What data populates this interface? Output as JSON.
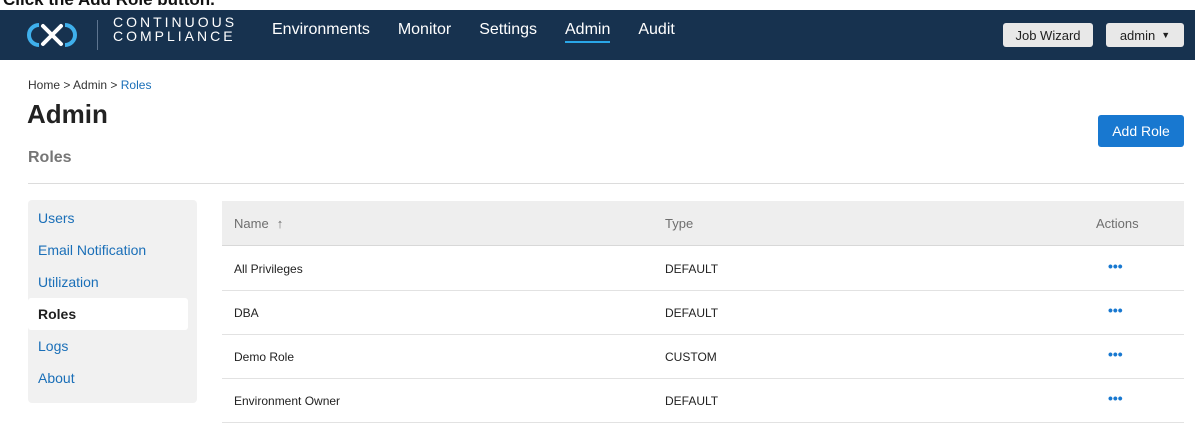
{
  "instruction": "Click the Add Role button.",
  "header": {
    "logo_line1": "CONTINUOUS",
    "logo_line2": "COMPLIANCE",
    "nav": [
      {
        "label": "Environments"
      },
      {
        "label": "Monitor"
      },
      {
        "label": "Settings"
      },
      {
        "label": "Admin",
        "active": true
      },
      {
        "label": "Audit"
      }
    ],
    "job_wizard_label": "Job Wizard",
    "user_label": "admin",
    "brand_color": "#17324f",
    "active_underline_color": "#2aa7e8"
  },
  "breadcrumb": {
    "home": "Home",
    "sep": ">",
    "admin": "Admin",
    "current": "Roles"
  },
  "page": {
    "title": "Admin",
    "section": "Roles",
    "add_button": "Add Role"
  },
  "sidebar": {
    "items": [
      {
        "label": "Users"
      },
      {
        "label": "Email Notification"
      },
      {
        "label": "Utilization"
      },
      {
        "label": "Roles",
        "active": true
      },
      {
        "label": "Logs"
      },
      {
        "label": "About"
      }
    ]
  },
  "table": {
    "columns": {
      "name": "Name",
      "type": "Type",
      "actions": "Actions"
    },
    "sort_icon": "arrow-up-icon",
    "rows": [
      {
        "name": "All Privileges",
        "type": "DEFAULT"
      },
      {
        "name": "DBA",
        "type": "DEFAULT"
      },
      {
        "name": "Demo Role",
        "type": "CUSTOM"
      },
      {
        "name": "Environment Owner",
        "type": "DEFAULT"
      }
    ],
    "action_glyph": "•••"
  }
}
